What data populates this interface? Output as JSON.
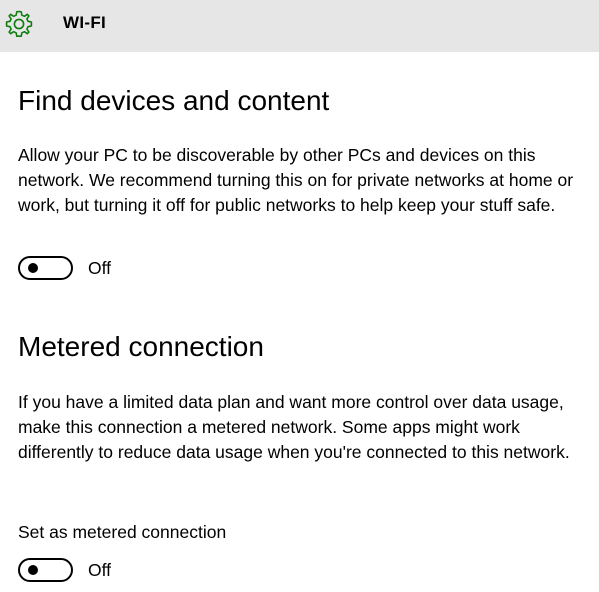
{
  "header": {
    "title": "WI-FI",
    "icon": "gear-icon",
    "icon_color": "#107c10"
  },
  "discovery": {
    "heading": "Find devices and content",
    "description": "Allow your PC to be discoverable by other PCs and devices on this network. We recommend turning this on for private networks at home or work, but turning it off for public networks to help keep your stuff safe.",
    "toggle_state": "Off"
  },
  "metered": {
    "heading": "Metered connection",
    "description": "If you have a limited data plan and want more control over data usage, make this connection a metered network. Some apps might work differently to reduce data usage when you're connected to this network.",
    "setting_label": "Set as metered connection",
    "toggle_state": "Off"
  }
}
